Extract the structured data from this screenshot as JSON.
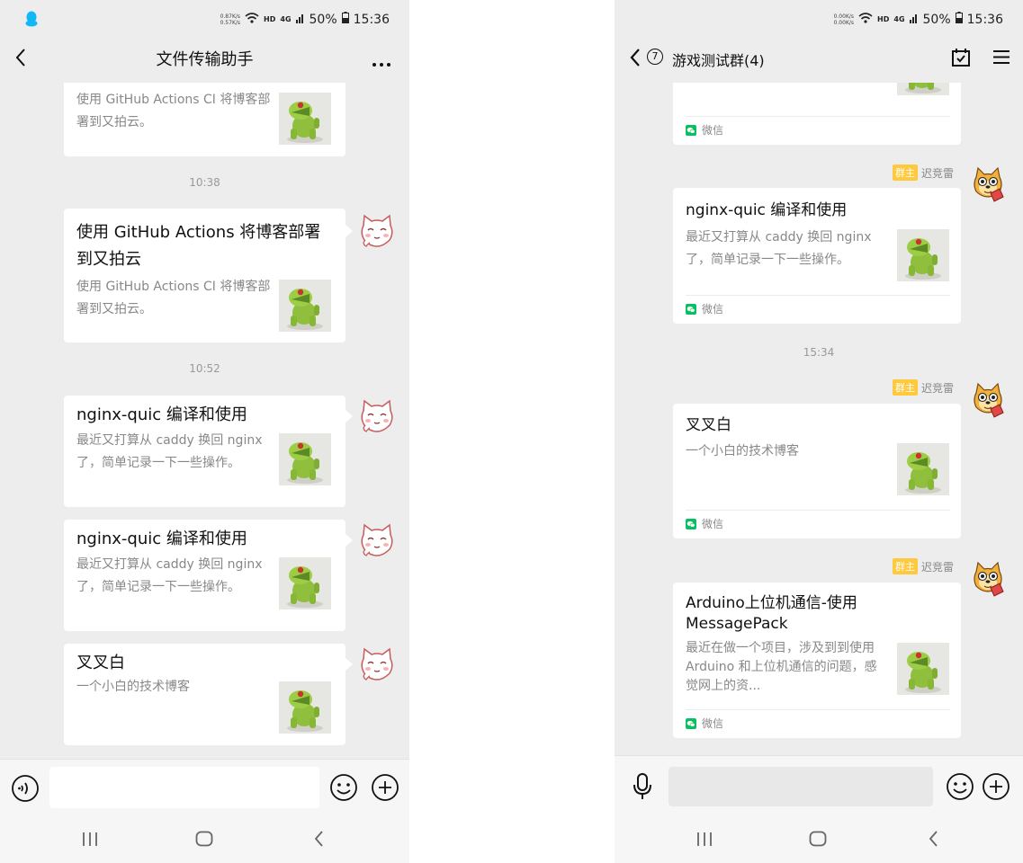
{
  "left": {
    "status": {
      "net_up": "0.87K/s",
      "net_down": "0.57K/s",
      "hd": "HD",
      "signal": "4G",
      "battery": "50%",
      "time": "15:36"
    },
    "header": {
      "title": "文件传输助手",
      "more": "···"
    },
    "messages": [
      {
        "desc": "使用 GitHub Actions CI 将博客部署到又拍云。"
      },
      {
        "time": "10:38"
      },
      {
        "title": "使用 GitHub Actions 将博客部署到又拍云",
        "desc": "使用 GitHub Actions CI 将博客部署到又拍云。"
      },
      {
        "time": "10:52"
      },
      {
        "title": "nginx-quic 编译和使用",
        "desc": "最近又打算从 caddy 换回 nginx 了，简单记录一下一些操作。"
      },
      {
        "title": "nginx-quic 编译和使用",
        "desc": "最近又打算从 caddy 换回 nginx 了，简单记录一下一些操作。"
      },
      {
        "title": "叉叉白",
        "desc": "一个小白的技术博客"
      }
    ]
  },
  "right": {
    "status": {
      "net_up": "0.00K/s",
      "net_down": "0.00K/s",
      "hd": "HD",
      "signal": "4G",
      "battery": "50%",
      "time": "15:36"
    },
    "header": {
      "unread": "7",
      "title": "游戏测试群(4)"
    },
    "messages": [
      {
        "source": "微信"
      },
      {
        "badge": "群主",
        "sender": "迟竞雷",
        "title": "nginx-quic 编译和使用",
        "desc": "最近又打算从 caddy 换回 nginx 了，简单记录一下一些操作。",
        "source": "微信"
      },
      {
        "time": "15:34"
      },
      {
        "badge": "群主",
        "sender": "迟竞雷",
        "title": "叉叉白",
        "desc": "一个小白的技术博客",
        "source": "微信"
      },
      {
        "badge": "群主",
        "sender": "迟竞雷",
        "title": "Arduino上位机通信-使用 MessagePack",
        "desc": "最近在做一个项目，涉及到到使用 Arduino 和上位机通信的问题，感觉网上的资...",
        "source": "微信"
      }
    ]
  },
  "colors": {
    "bg": "#ededed",
    "card": "#ffffff",
    "badge": "#ffc93d",
    "wechat_green": "#07c160",
    "qq_blue": "#12b7f5"
  },
  "icons": [
    "qq-icon",
    "back-icon",
    "more-icon",
    "voice-icon",
    "emoji-icon",
    "plus-icon",
    "microphone-icon",
    "calendar-check-icon",
    "menu-icon",
    "wechat-icon",
    "recents-icon",
    "home-icon",
    "nav-back-icon"
  ]
}
